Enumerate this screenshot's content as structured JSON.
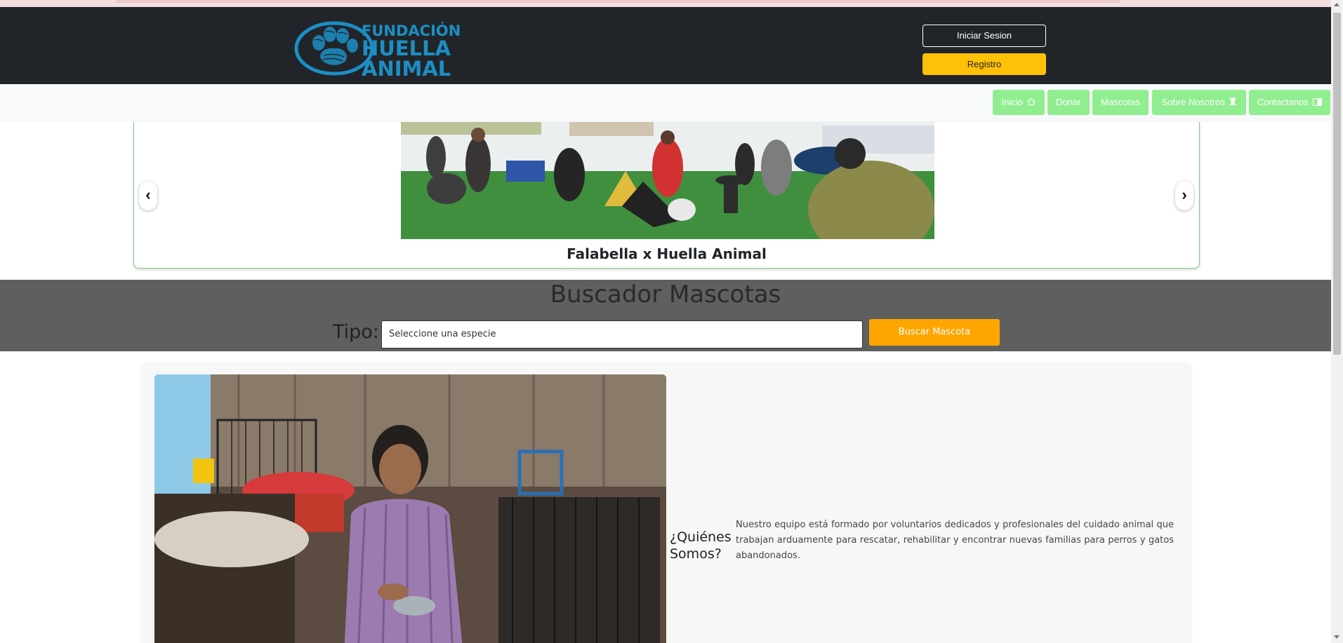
{
  "header": {
    "logo": {
      "line1": "FUNDACIÓN",
      "line2": "HUELLA",
      "line3": "ANIMAL",
      "color": "#1b8fc4"
    },
    "login_label": "Iniciar Sesion",
    "register_label": "Registro"
  },
  "nav": {
    "items": [
      {
        "label": "Inicio",
        "icon": "house-icon"
      },
      {
        "label": "Donar",
        "icon": ""
      },
      {
        "label": "Mascotas",
        "icon": ""
      },
      {
        "label": "Sobre Nosotros",
        "icon": "chess-rook-icon"
      },
      {
        "label": "Contactanos",
        "icon": "book-icon"
      }
    ],
    "color": "#90ee90"
  },
  "carousel": {
    "caption": "Falabella x Huella Animal",
    "prev_icon": "chevron-left-icon",
    "next_icon": "chevron-right-icon"
  },
  "search": {
    "title": "Buscador Mascotas",
    "tipo_label": "Tipo:",
    "select_value": "Seleccione una especie",
    "button_label": "Buscar Mascota",
    "button_color": "#ffa500"
  },
  "about": {
    "heading": "¿Quiénes Somos?",
    "text": "Nuestro equipo está formado por voluntarios dedicados y profesionales del cuidado animal que trabajan arduamente para rescatar, rehabilitar y encontrar nuevas familias para perros y gatos abandonados."
  },
  "colors": {
    "header_bg": "#212529",
    "register_bg": "#ffc107",
    "search_band_bg": "#5f5f5f"
  }
}
